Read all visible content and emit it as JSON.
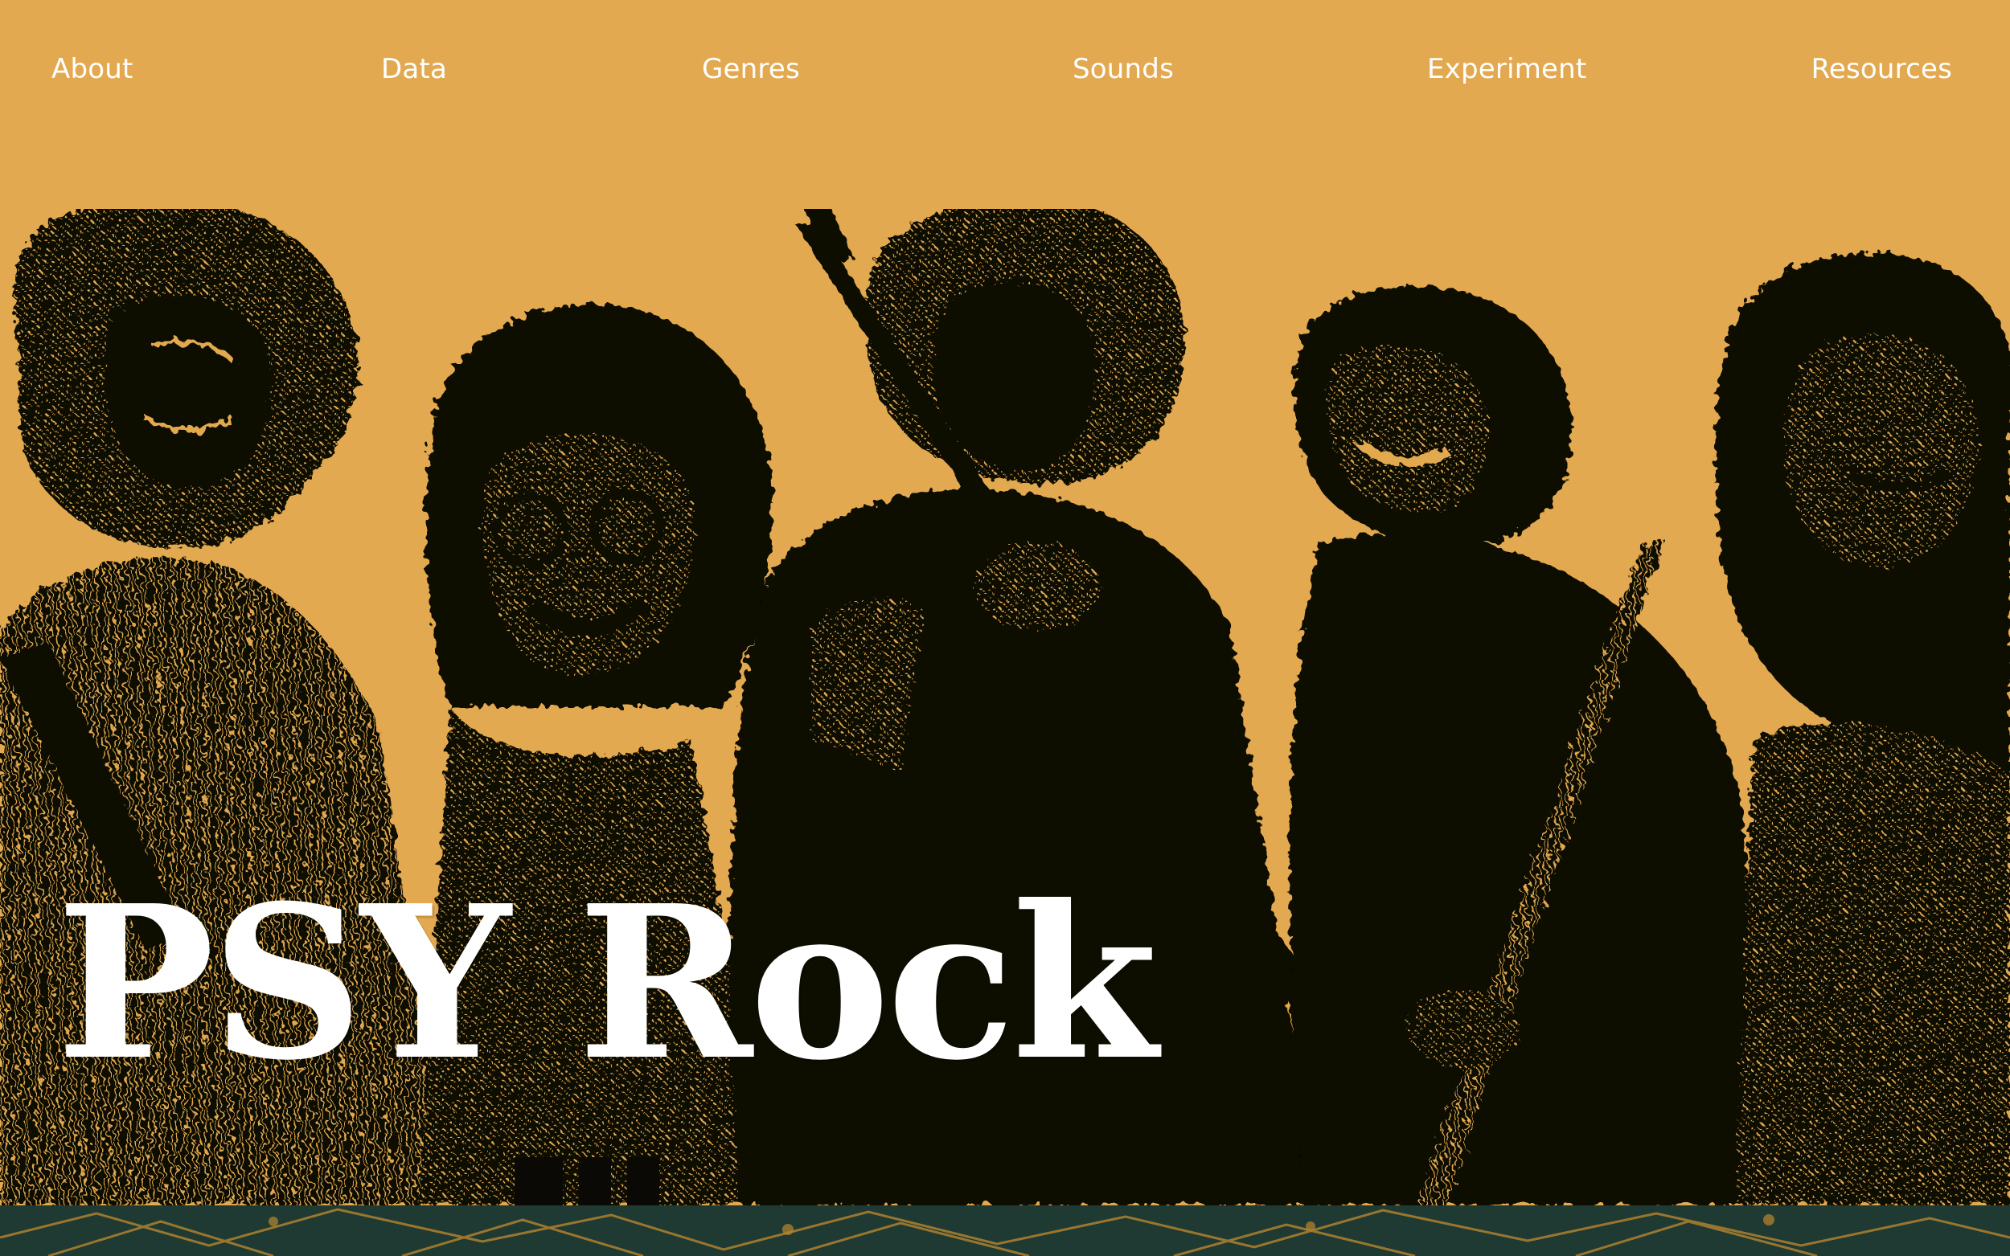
{
  "nav": {
    "about": "About",
    "data": "Data",
    "genres": "Genres",
    "sounds": "Sounds",
    "experiment": "Experiment",
    "resources": "Resources"
  },
  "hero": {
    "title": "PSY Rock",
    "artwork_icon": "band-photo-collage-icon"
  },
  "colors": {
    "background": "#E3A950",
    "ink": "#0B0905",
    "title": "#FFFFFF",
    "strip": "#1F3A33",
    "strip_pattern": "#B8862F"
  }
}
